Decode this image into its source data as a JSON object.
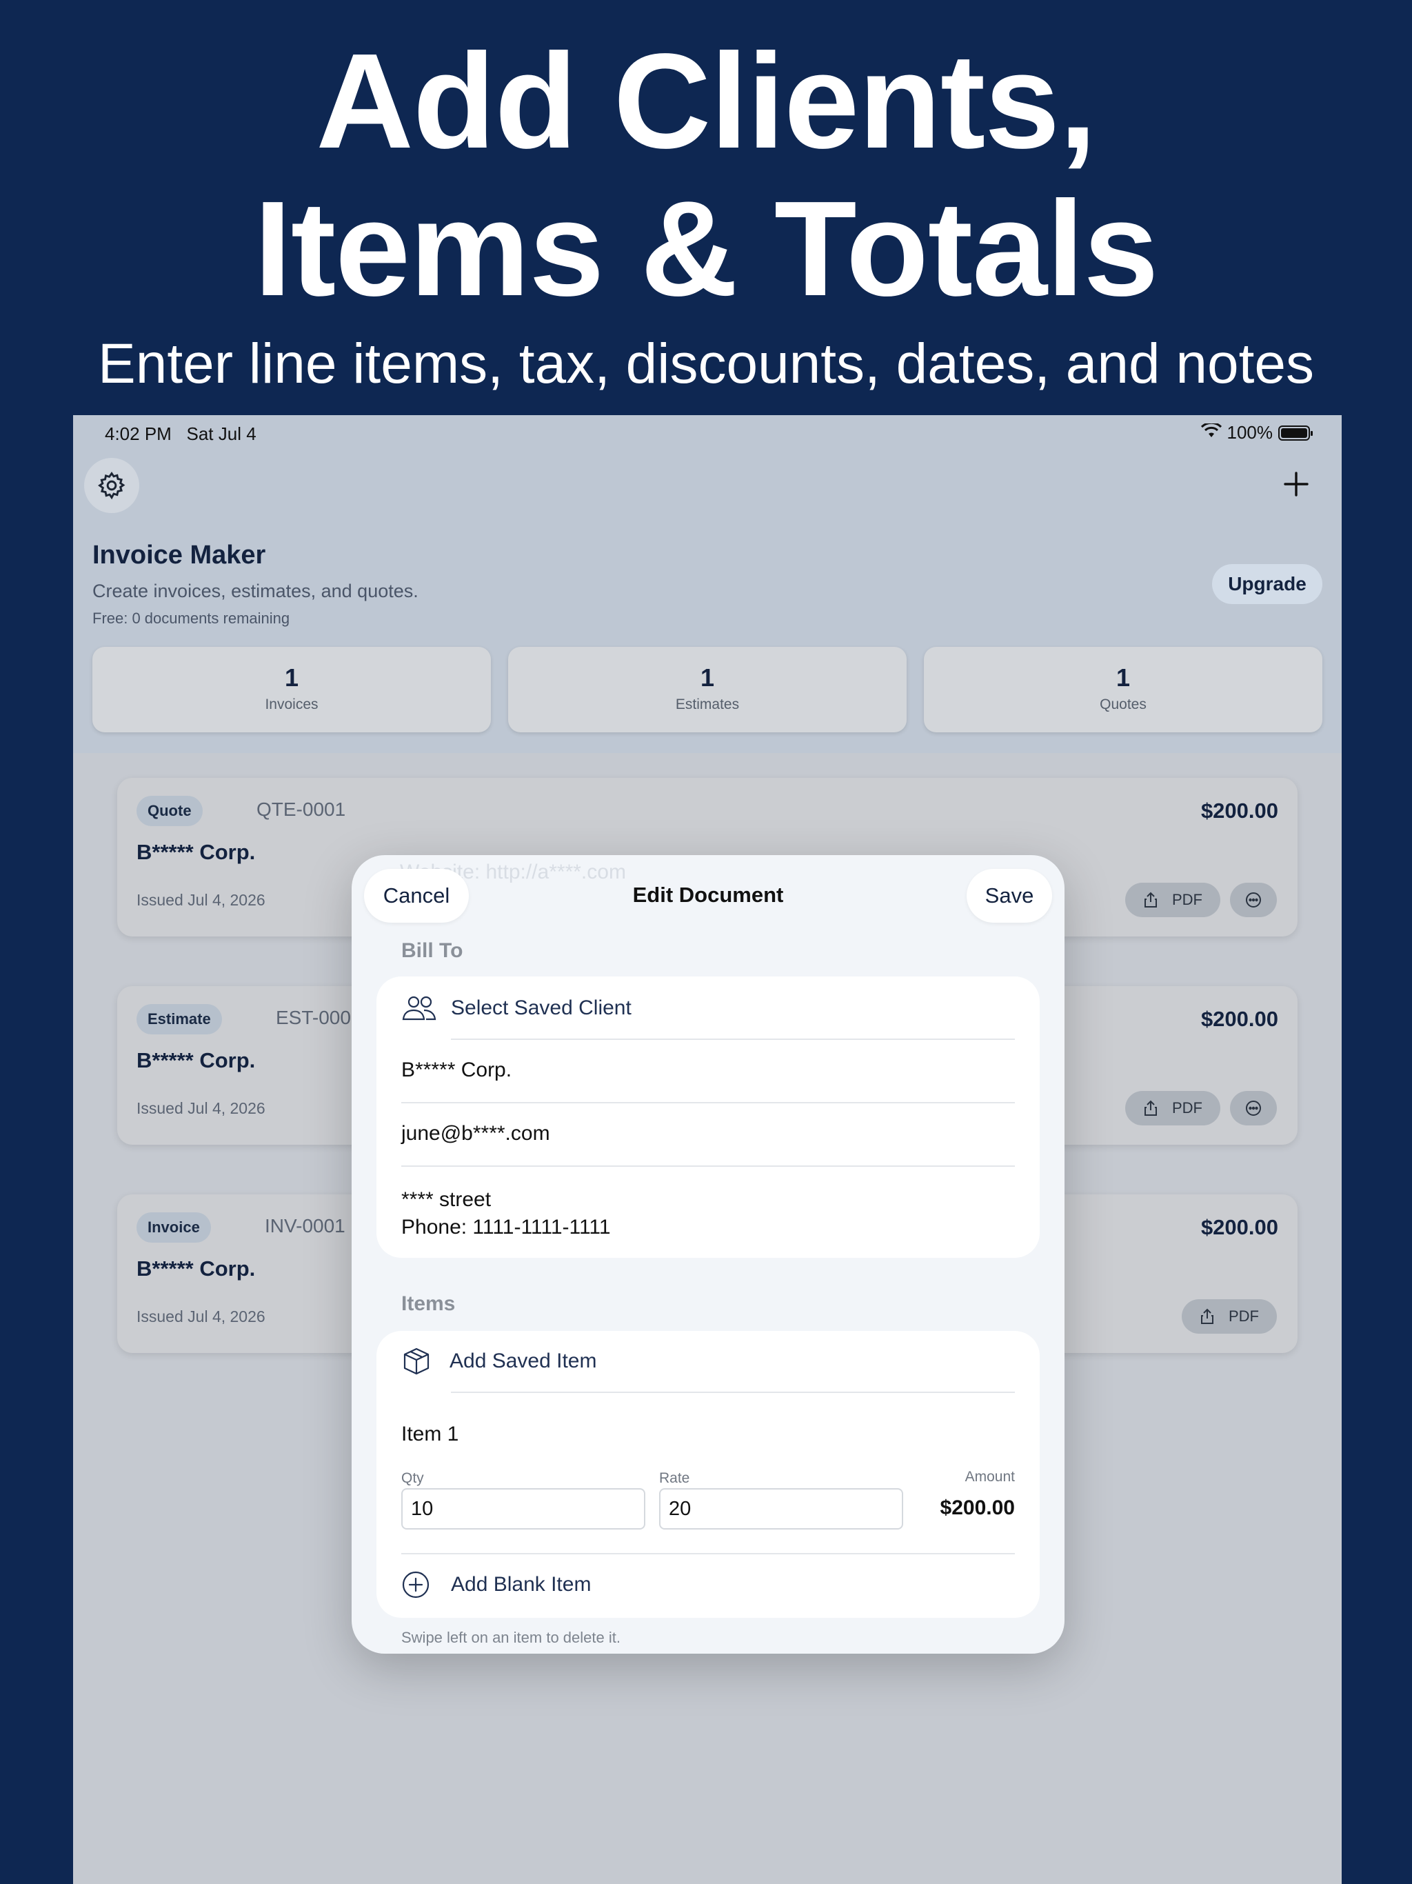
{
  "hero": {
    "title_line1": "Add Clients,",
    "title_line2": "Items & Totals",
    "subtitle": "Enter line items, tax, discounts, dates, and notes"
  },
  "status_bar": {
    "time": "4:02 PM",
    "date": "Sat Jul 4",
    "battery": "100%"
  },
  "app": {
    "title": "Invoice Maker",
    "description": "Create invoices, estimates, and quotes.",
    "free_note": "Free: 0 documents remaining",
    "upgrade_label": "Upgrade"
  },
  "stats": [
    {
      "value": "1",
      "label": "Invoices"
    },
    {
      "value": "1",
      "label": "Estimates"
    },
    {
      "value": "1",
      "label": "Quotes"
    }
  ],
  "documents": [
    {
      "type": "Quote",
      "number": "QTE-0001",
      "client": "B***** Corp.",
      "issued": "Issued Jul 4, 2026",
      "amount": "$200.00",
      "pdf_label": "PDF"
    },
    {
      "type": "Estimate",
      "number": "EST-0001",
      "client": "B***** Corp.",
      "issued": "Issued Jul 4, 2026",
      "amount": "$200.00",
      "pdf_label": "PDF"
    },
    {
      "type": "Invoice",
      "number": "INV-0001",
      "client": "B***** Corp.",
      "issued": "Issued Jul 4, 2026",
      "amount": "$200.00",
      "pdf_label": "PDF"
    }
  ],
  "modal": {
    "cancel_label": "Cancel",
    "title": "Edit Document",
    "save_label": "Save",
    "faint_text": "Website: http://a****.com",
    "bill_to": {
      "header": "Bill To",
      "select_client_label": "Select Saved Client",
      "name": "B***** Corp.",
      "email": "june@b****.com",
      "address_line1": "**** street",
      "address_line2": "Phone: 1111-1111-1111"
    },
    "items": {
      "header": "Items",
      "add_saved_label": "Add Saved Item",
      "item_name": "Item 1",
      "qty_label": "Qty",
      "qty_value": "10",
      "rate_label": "Rate",
      "rate_value": "20",
      "amount_label": "Amount",
      "amount_value": "$200.00",
      "add_blank_label": "Add Blank Item"
    },
    "hint": "Swipe left on an item to delete it."
  },
  "colors": {
    "background": "#0e2752",
    "accent_text": "#13223f"
  }
}
